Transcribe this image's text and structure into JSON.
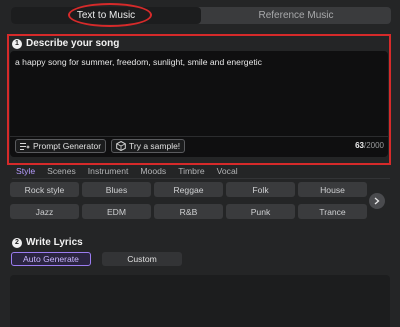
{
  "mode_tabs": [
    {
      "label": "Text to Music",
      "active": true
    },
    {
      "label": "Reference Music",
      "active": false
    }
  ],
  "describe": {
    "number": "1",
    "title": "Describe your song",
    "prompt_text": "a happy song for summer, freedom, sunlight, smile and energetic",
    "prompt_generator_label": "Prompt Generator",
    "try_sample_label": "Try a sample!",
    "char_count": "63",
    "char_limit": "/2000"
  },
  "category_tabs": [
    {
      "label": "Style",
      "active": true
    },
    {
      "label": "Scenes",
      "active": false
    },
    {
      "label": "Instrument",
      "active": false
    },
    {
      "label": "Moods",
      "active": false
    },
    {
      "label": "Timbre",
      "active": false
    },
    {
      "label": "Vocal",
      "active": false
    }
  ],
  "styles_row1": [
    "Rock style",
    "Blues",
    "Reggae",
    "Folk",
    "House"
  ],
  "styles_row2": [
    "Jazz",
    "EDM",
    "R&B",
    "Punk",
    "Trance"
  ],
  "lyrics": {
    "number": "2",
    "title": "Write Lyrics",
    "auto_label": "Auto Generate",
    "custom_label": "Custom"
  },
  "colors": {
    "accent": "#b69cff",
    "highlight": "#d62a2a",
    "background": "#242526"
  }
}
